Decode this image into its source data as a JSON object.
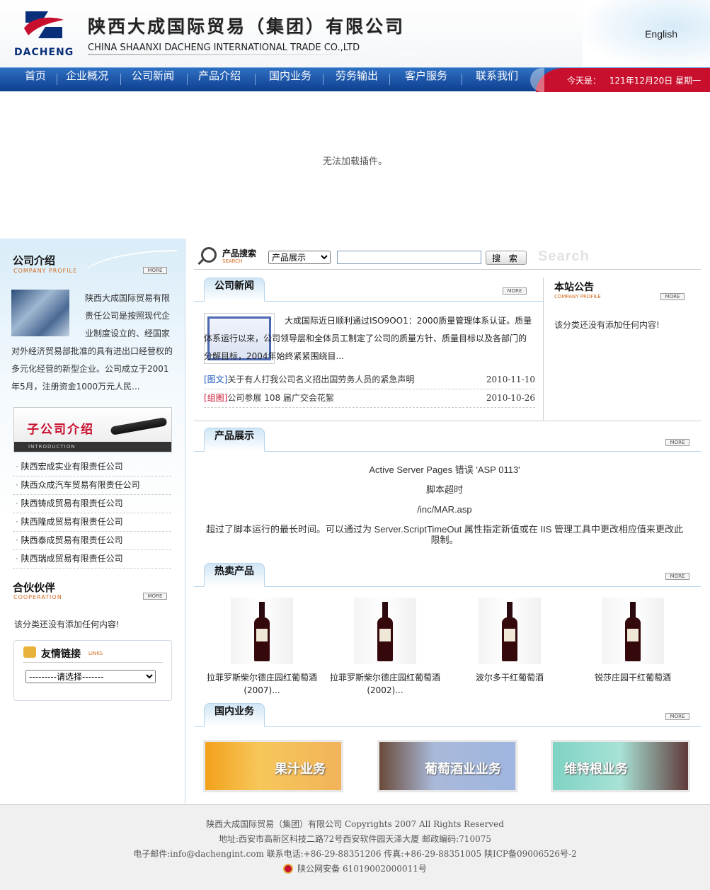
{
  "header": {
    "logo_text": "DACHENG",
    "company_name": "陕西大成国际贸易（集团）有限公司",
    "company_name_en": "CHINA SHAANXI DACHENG INTERNATIONAL TRADE  CO.,LTD",
    "english_link": "English"
  },
  "nav": {
    "items": [
      "首页",
      "企业概况",
      "公司新闻",
      "产品介绍",
      "国内业务",
      "劳务输出",
      "客户服务",
      "联系我们"
    ],
    "date_label": "今天是：",
    "date_value": "121年12月20日  星期一"
  },
  "plugin_message": "无法加载插件。",
  "sidebar": {
    "intro": {
      "title": "公司介绍",
      "subtitle": "COMPANY PROFILE",
      "more": "MORE",
      "text": "陕西大成国际贸易有限责任公司是按照现代企业制度设立的、经国家对外经济贸易部批准的具有进出口经营权的多元化经营的新型企业。公司成立于2001年5月，注册资金1000万元人民..."
    },
    "subsidiary": {
      "title": "子公司介绍",
      "subtitle": "INTRODUCTION",
      "items": [
        "陕西宏成实业有限责任公司",
        "陕西众成汽车贸易有限责任公司",
        "陕西铸成贸易有限责任公司",
        "陕西隆成贸易有限责任公司",
        "陕西泰成贸易有限责任公司",
        "陕西瑞成贸易有限责任公司"
      ]
    },
    "partner": {
      "title": "合伙伙伴",
      "subtitle": "COOPERATION",
      "more": "MORE",
      "empty": "该分类还没有添加任何内容!"
    },
    "links": {
      "title": "友情链接",
      "subtitle": "LINKS",
      "select_value": "---------请选择-------"
    }
  },
  "search": {
    "label": "产品搜索",
    "sublabel": "SEARCH",
    "category": "产品展示",
    "input_value": "",
    "button": "搜 索",
    "watermark": "Search"
  },
  "news": {
    "title": "公司新闻",
    "more": "MORE",
    "feature_text": "大成国际近日顺利通过ISO9OO1：2000质量管理体系认证。质量体系运行以来，公司领导层和全体员工制定了公司的质量方针、质量目标以及各部门的分解目标，2004年始终紧紧围绕目...",
    "rows": [
      {
        "tag": "[图文]",
        "title": "关于有人打我公司名义招出国劳务人员的紧急声明",
        "date": "2010-11-10"
      },
      {
        "tag": "[组图]",
        "title": "公司参展 108 届广交会花絮",
        "date": "2010-10-26"
      }
    ]
  },
  "notice": {
    "title": "本站公告",
    "subtitle": "COMPANY PROFILE",
    "more": "MORE",
    "empty": "该分类还没有添加任何内容!"
  },
  "products": {
    "title": "产品展示",
    "more": "MORE",
    "error_lines": [
      "Active Server Pages 错误 'ASP 0113'",
      "脚本超时",
      "/inc/MAR.asp",
      "超过了脚本运行的最长时间。可以通过为 Server.ScriptTimeOut 属性指定新值或在 IIS 管理工具中更改相应值来更改此限制。"
    ]
  },
  "hot": {
    "title": "热卖产品",
    "more": "MORE",
    "items": [
      {
        "name": "拉菲罗斯柴尔德庄园红葡萄酒(2007)..."
      },
      {
        "name": "拉菲罗斯柴尔德庄园红葡萄酒(2002)..."
      },
      {
        "name": "波尔多干红葡萄酒"
      },
      {
        "name": "锐莎庄园干红葡萄酒"
      }
    ]
  },
  "domestic": {
    "title": "国内业务",
    "more": "MORE",
    "tiles": [
      "果汁业务",
      "葡萄酒业业务",
      "维特根业务"
    ]
  },
  "footer": {
    "line1": "陕西大成国际贸易（集团）有限公司 Copyrights 2007 All Rights Reserved",
    "line2": "地址:西安市高新区科技二路72号西安软件园天泽大厦 邮政编码:710075",
    "line3": "电子邮件:info@dachengint.com 联系电话:+86-29-88351206 传真:+86-29-88351005 陕ICP备09006526号-2",
    "line4": "陕公网安备 61019002000011号"
  },
  "colors": {
    "nav_blue": "#1a4f9f",
    "accent_red": "#c8102e",
    "subtitle_orange": "#d2691e"
  }
}
